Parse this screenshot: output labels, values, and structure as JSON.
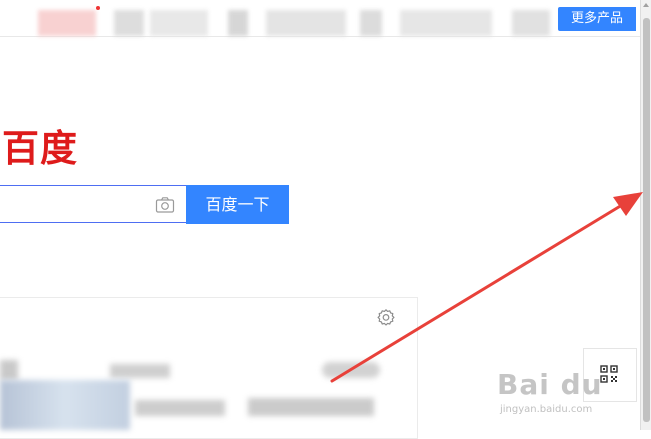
{
  "header": {
    "more_products_label": "更多产品"
  },
  "logo": {
    "text": "百度"
  },
  "search": {
    "button_label": "百度一下",
    "placeholder": ""
  },
  "watermark": {
    "brand": "Bai du",
    "sub": "jingyan.baidu.com"
  },
  "colors": {
    "brand_red": "#de1b1b",
    "accent_blue": "#3385ff",
    "annotation_red": "#e8413a"
  }
}
